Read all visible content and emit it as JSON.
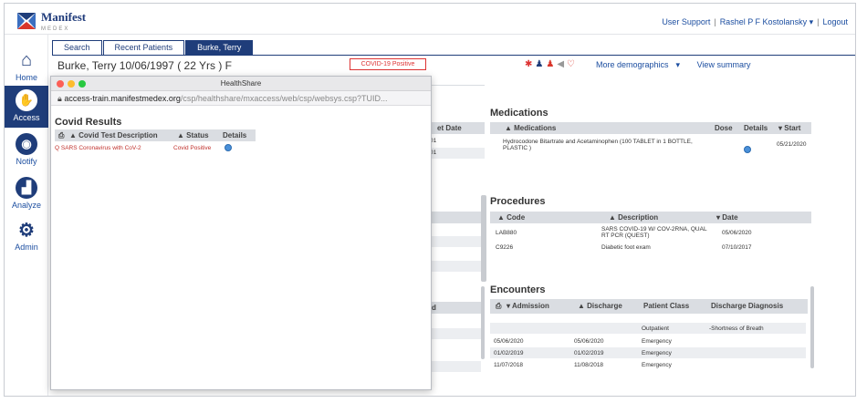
{
  "header": {
    "logo_name": "Manifest",
    "logo_sub": "MEDEX",
    "user_support": "User Support",
    "user_name": "Rashel P F Kostolansky",
    "user_caret": "▾",
    "logout": "Logout"
  },
  "leftnav": {
    "items": [
      {
        "label": "Home",
        "icon": "home-icon"
      },
      {
        "label": "Access",
        "icon": "access-icon"
      },
      {
        "label": "Notify",
        "icon": "notify-icon"
      },
      {
        "label": "Analyze",
        "icon": "analyze-icon"
      },
      {
        "label": "Admin",
        "icon": "gear-icon"
      }
    ]
  },
  "tabs": [
    "Search",
    "Recent Patients",
    "Burke, Terry"
  ],
  "patient": {
    "name_line": "Burke, Terry  10/06/1997  ( 22 Yrs )  F",
    "covid_badge": "COVID-19 Positive",
    "more_demographics": "More demographics",
    "caret": "▾",
    "view_summary": "View summary"
  },
  "background": {
    "col_fragment": "et Date",
    "date_frag_1": "01",
    "date_frag_2": "01",
    "col_fragment_2": "d",
    "medications": {
      "title": "Medications",
      "headers": [
        "▲ Medications",
        "Dose",
        "Details",
        "▾ Start"
      ],
      "rows": [
        {
          "name": "Hydrocodone Bitartrate and Acetaminophen (100 TABLET in 1 BOTTLE, PLASTIC )",
          "dose": "",
          "start": "05/21/2020"
        }
      ]
    },
    "procedures": {
      "title": "Procedures",
      "headers": [
        "▲ Code",
        "▲ Description",
        "▾ Date"
      ],
      "rows": [
        {
          "code": "LAB880",
          "description": "SARS COVID-19 W/ COV-2RNA, QUAL RT PCR (QUEST)",
          "date": "05/06/2020"
        },
        {
          "code": "C9226",
          "description": "Diabetic foot exam",
          "date": "07/10/2017"
        }
      ]
    },
    "encounters": {
      "title": "Encounters",
      "headers": [
        "▾ Admission",
        "▲ Discharge",
        "Patient Class",
        "Discharge Diagnosis"
      ],
      "rows": [
        {
          "admission": "",
          "discharge": "",
          "class": "Outpatient",
          "diagnosis": "-Shortness of Breath"
        },
        {
          "admission": "05/06/2020",
          "discharge": "05/06/2020",
          "class": "Emergency",
          "diagnosis": ""
        },
        {
          "admission": "01/02/2019",
          "discharge": "01/02/2019",
          "class": "Emergency",
          "diagnosis": ""
        },
        {
          "admission": "11/07/2018",
          "discharge": "11/08/2018",
          "class": "Emergency",
          "diagnosis": ""
        }
      ]
    }
  },
  "popup": {
    "window_title": "HealthShare",
    "url_host": "access-train.manifestmedex.org",
    "url_path": "/csp/healthshare/mxaccess/web/csp/websys.csp?TUID...",
    "section_title": "Covid Results",
    "headers": [
      "▲ Covid Test Description",
      "▲ Status",
      "Details"
    ],
    "rows": [
      {
        "description": "Q SARS Coronavirus with CoV-2",
        "status": "Covid Positive"
      }
    ]
  },
  "colors": {
    "brand_blue": "#1f3d7a",
    "link_blue": "#1c4ea0",
    "alert_red": "#c0302b"
  }
}
